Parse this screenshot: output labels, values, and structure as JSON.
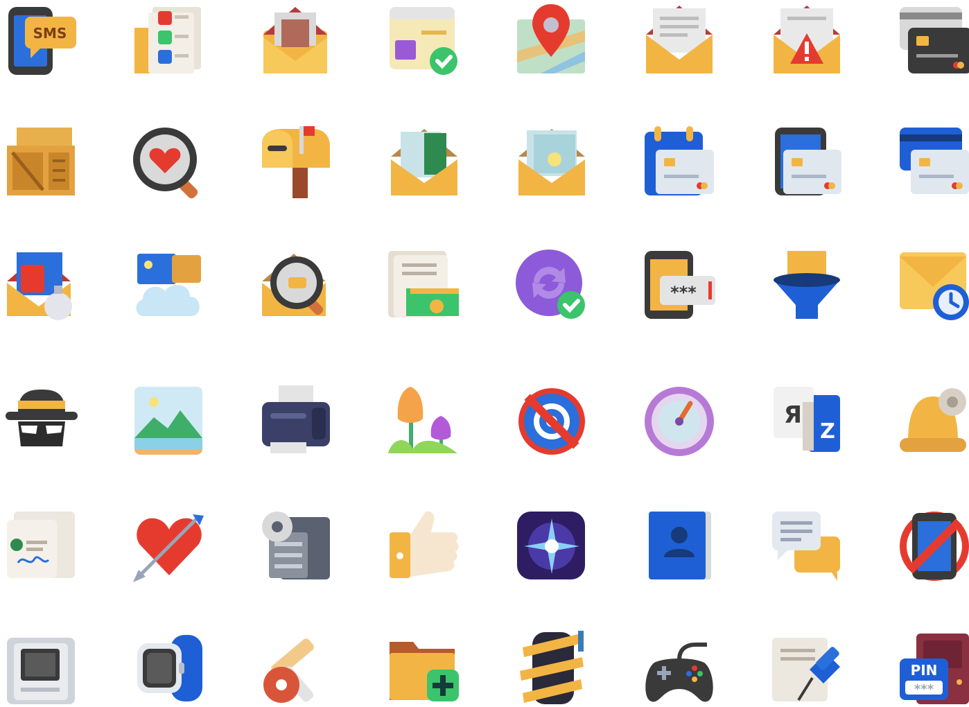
{
  "colors": {
    "envelope": "#f2b544",
    "envelope_flap": "#f7c95a",
    "paper": "#e9e9e9",
    "dark": "#3a3a3a",
    "blue": "#1f5fd6",
    "red": "#e53b2f",
    "green": "#3bc46b",
    "purple": "#8d5ad9",
    "navy": "#3b4068",
    "wood": "#e3a23f"
  },
  "icons": [
    [
      "sms-phone-icon",
      "playlist-document-icon",
      "package-envelope-icon",
      "approved-image-document-icon",
      "map-location-pin-icon",
      "letter-envelope-icon",
      "warning-envelope-icon",
      "credit-cards-icon"
    ],
    [
      "wooden-crates-icon",
      "heart-magnifier-icon",
      "mailbox-icon",
      "money-envelope-icon",
      "tickets-envelope-icon",
      "calendar-credit-card-icon",
      "phone-credit-card-icon",
      "credit-card-stack-icon"
    ],
    [
      "music-attachment-envelope-icon",
      "cloud-gallery-icon",
      "search-envelope-icon",
      "invoice-money-icon",
      "sync-done-icon",
      "phone-password-icon",
      "envelope-funnel-icon",
      "scheduled-envelope-icon"
    ],
    [
      "incognito-icon",
      "landscape-picture-icon",
      "printer-icon",
      "tulips-icon",
      "no-email-icon",
      "speedometer-icon",
      "translate-icon",
      "bell-settings-icon"
    ],
    [
      "signed-contract-icon",
      "heart-arrow-icon",
      "server-settings-icon",
      "thumbs-up-icon",
      "sparkle-tile-icon",
      "contacts-book-icon",
      "chat-messages-icon",
      "no-phone-icon"
    ],
    [
      "computer-case-icon",
      "smartwatch-icon",
      "keys-icon",
      "add-folder-icon",
      "tape-coil-icon",
      "gamepad-icon",
      "pinned-document-icon",
      "pin-door-icon"
    ]
  ],
  "labels": {
    "sms": "SMS",
    "password": "***",
    "translate_a": "Я",
    "translate_b": "Z",
    "pin": "PIN",
    "pin_stars": "***"
  }
}
